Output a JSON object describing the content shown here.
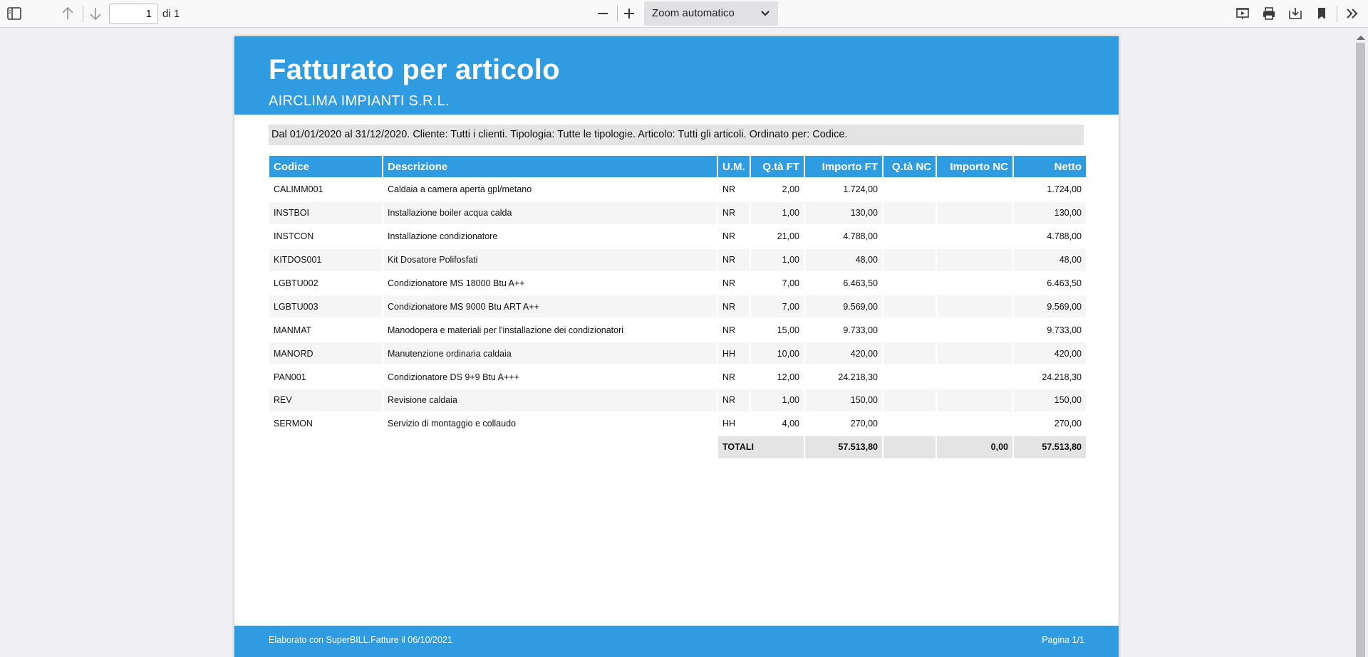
{
  "toolbar": {
    "page_current": "1",
    "page_total": "di 1",
    "zoom": "Zoom automatico",
    "icons": [
      "sidebar-toggle-icon",
      "arrow-up-icon",
      "arrow-down-icon",
      "zoom-out-icon",
      "zoom-in-icon",
      "presentation-icon",
      "print-icon",
      "download-icon",
      "bookmark-icon",
      "more-tools-icon"
    ]
  },
  "report": {
    "title": "Fatturato per articolo",
    "company": "AIRCLIMA IMPIANTI S.R.L.",
    "filter": "Dal 01/01/2020 al 31/12/2020. Cliente: Tutti i clienti. Tipologia: Tutte le tipologie. Articolo: Tutti gli articoli. Ordinato per: Codice.",
    "columns": [
      "Codice",
      "Descrizione",
      "U.M.",
      "Q.tà FT",
      "Importo FT",
      "Q.tà NC",
      "Importo NC",
      "Netto"
    ],
    "rows": [
      {
        "codice": "CALIMM001",
        "descrizione": "Caldaia a camera aperta gpl/metano",
        "um": "NR",
        "qta_ft": "2,00",
        "importo_ft": "1.724,00",
        "qta_nc": "",
        "importo_nc": "",
        "netto": "1.724,00"
      },
      {
        "codice": "INSTBOI",
        "descrizione": "Installazione boiler acqua calda",
        "um": "NR",
        "qta_ft": "1,00",
        "importo_ft": "130,00",
        "qta_nc": "",
        "importo_nc": "",
        "netto": "130,00"
      },
      {
        "codice": "INSTCON",
        "descrizione": "Installazione condizionatore",
        "um": "NR",
        "qta_ft": "21,00",
        "importo_ft": "4.788,00",
        "qta_nc": "",
        "importo_nc": "",
        "netto": "4.788,00"
      },
      {
        "codice": "KITDOS001",
        "descrizione": "Kit Dosatore Polifosfati",
        "um": "NR",
        "qta_ft": "1,00",
        "importo_ft": "48,00",
        "qta_nc": "",
        "importo_nc": "",
        "netto": "48,00"
      },
      {
        "codice": "LGBTU002",
        "descrizione": "Condizionatore MS 18000 Btu A++",
        "um": "NR",
        "qta_ft": "7,00",
        "importo_ft": "6.463,50",
        "qta_nc": "",
        "importo_nc": "",
        "netto": "6.463,50"
      },
      {
        "codice": "LGBTU003",
        "descrizione": "Condizionatore MS 9000 Btu ART A++",
        "um": "NR",
        "qta_ft": "7,00",
        "importo_ft": "9.569,00",
        "qta_nc": "",
        "importo_nc": "",
        "netto": "9.569,00"
      },
      {
        "codice": "MANMAT",
        "descrizione": "Manodopera e materiali per l'installazione dei condizionatori",
        "um": "NR",
        "qta_ft": "15,00",
        "importo_ft": "9.733,00",
        "qta_nc": "",
        "importo_nc": "",
        "netto": "9.733,00"
      },
      {
        "codice": "MANORD",
        "descrizione": "Manutenzione ordinaria caldaia",
        "um": "HH",
        "qta_ft": "10,00",
        "importo_ft": "420,00",
        "qta_nc": "",
        "importo_nc": "",
        "netto": "420,00"
      },
      {
        "codice": "PAN001",
        "descrizione": "Condizionatore DS 9+9 Btu A+++",
        "um": "NR",
        "qta_ft": "12,00",
        "importo_ft": "24.218,30",
        "qta_nc": "",
        "importo_nc": "",
        "netto": "24.218,30"
      },
      {
        "codice": "REV",
        "descrizione": "Revisione caldaia",
        "um": "NR",
        "qta_ft": "1,00",
        "importo_ft": "150,00",
        "qta_nc": "",
        "importo_nc": "",
        "netto": "150,00"
      },
      {
        "codice": "SERMON",
        "descrizione": "Servizio di montaggio e collaudo",
        "um": "HH",
        "qta_ft": "4,00",
        "importo_ft": "270,00",
        "qta_nc": "",
        "importo_nc": "",
        "netto": "270,00"
      }
    ],
    "totals": {
      "label": "TOTALI",
      "importo_ft": "57.513,80",
      "importo_nc": "0,00",
      "netto": "57.513,80"
    },
    "footer_left": "Elaborato con SuperBILL.Fatture il 06/10/2021",
    "footer_right": "Pagina 1/1"
  },
  "colors": {
    "accent": "#2f9be0",
    "band_grey": "#e4e4e4",
    "row_alt": "#f5f5f5"
  }
}
